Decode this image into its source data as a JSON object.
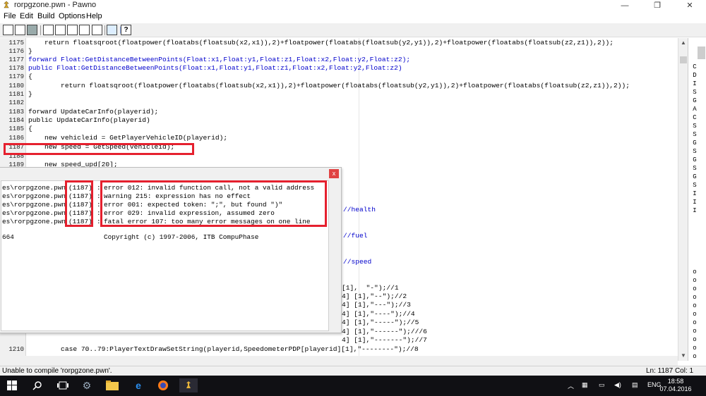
{
  "window": {
    "title": "rorpgzone.pwn - Pawno",
    "minimize": "—",
    "maximize": "❐",
    "close": "✕"
  },
  "menu": [
    "File",
    "Edit",
    "Build",
    "Options",
    "Help"
  ],
  "editor": {
    "lines": [
      {
        "num": "1175",
        "text": "    return floatsqroot(floatpower(floatabs(floatsub(x2,x1)),2)+floatpower(floatabs(floatsub(y2,y1)),2)+floatpower(floatabs(floatsub(z2,z1)),2));"
      },
      {
        "num": "1176",
        "text": "}"
      },
      {
        "num": "1177",
        "text": "forward Float:GetDistanceBetweenPoints(Float:x1,Float:y1,Float:z1,Float:x2,Float:y2,Float:z2);"
      },
      {
        "num": "1178",
        "text": "public Float:GetDistanceBetweenPoints(Float:x1,Float:y1,Float:z1,Float:x2,Float:y2,Float:z2)"
      },
      {
        "num": "1179",
        "text": "{"
      },
      {
        "num": "1180",
        "text": "        return floatsqroot(floatpower(floatabs(floatsub(x2,x1)),2)+floatpower(floatabs(floatsub(y2,y1)),2)+floatpower(floatabs(floatsub(z2,z1)),2));"
      },
      {
        "num": "1181",
        "text": "}"
      },
      {
        "num": "1182",
        "text": ""
      },
      {
        "num": "1183",
        "text": "forward UpdateCarInfo(playerid);"
      },
      {
        "num": "1184",
        "text": "public UpdateCarInfo(playerid)"
      },
      {
        "num": "1185",
        "text": "{"
      },
      {
        "num": "1186",
        "text": "    new vehicleid = GetPlayerVehicleID(playerid);"
      },
      {
        "num": "1187",
        "text": "    new speed = GetSpeed(vehicleid);"
      },
      {
        "num": "1188",
        "text": ""
      },
      {
        "num": "1189",
        "text": "    new speed_upd[20];"
      }
    ],
    "partial_lines": [
      {
        "text": "//health"
      },
      {
        "text": "//fuel"
      },
      {
        "text": "//speed"
      },
      {
        "text": "[1],  \"-\");//1"
      },
      {
        "text": "4] [1],\"--\");//2"
      },
      {
        "text": "4] [1],\"---\");//3"
      },
      {
        "text": "4] [1],\"----\");//4"
      },
      {
        "text": "4] [1],\"-----\");//5"
      },
      {
        "text": "4] [1],\"------\");///6"
      },
      {
        "text": "4] [1],\"-------\");//7"
      }
    ],
    "last_line": {
      "num": "1210",
      "text": "        case 70..79:PlayerTextDrawSetString(playerid,SpeedometerPDP[playerid][1],\"--------\");//8"
    }
  },
  "side_letters": [
    "C",
    "D",
    "I",
    "S",
    "G",
    "A",
    "C",
    "S",
    "S",
    "G",
    "S",
    "G",
    "S",
    "G",
    "S",
    "I",
    "I",
    "I"
  ],
  "side_dots": [
    "o",
    "o",
    "o",
    "o",
    "o",
    "o",
    "o",
    "o",
    "o",
    "o",
    "o"
  ],
  "compiler": {
    "close": "x",
    "messages": [
      {
        "file": "es\\rorpgzone.pwn",
        "line": "(1187)",
        "msg": "error 012: invalid function call, not a valid address"
      },
      {
        "file": "es\\rorpgzone.pwn",
        "line": "(1187)",
        "msg": "warning 215: expression has no effect"
      },
      {
        "file": "es\\rorpgzone.pwn",
        "line": "(1187)",
        "msg": "error 001: expected token: \";\", but found \")\""
      },
      {
        "file": "es\\rorpgzone.pwn",
        "line": "(1187)",
        "msg": "error 029: invalid expression, assumed zero"
      },
      {
        "file": "es\\rorpgzone.pwn",
        "line": "(1187)",
        "msg": "fatal error 107: too many error messages on one line"
      }
    ],
    "footer_left": "664",
    "footer_right": "Copyright (c) 1997-2006, ITB CompuPhase"
  },
  "status": {
    "message": "Unable to compile 'rorpgzone.pwn'.",
    "position": "Ln: 1187  Col: 1"
  },
  "taskbar": {
    "lang": "ENG",
    "time": "18:58",
    "date": "07.04.2016"
  },
  "colors": {
    "highlight": "#e5202e",
    "keyword": "#0000cc"
  }
}
